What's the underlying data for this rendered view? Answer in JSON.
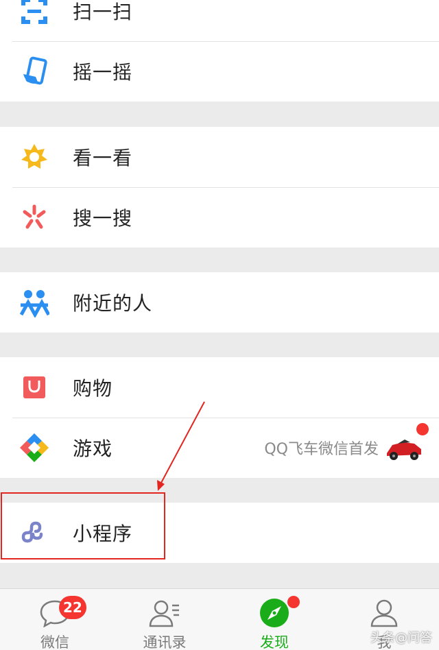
{
  "menu": {
    "scan": "扫一扫",
    "shake": "摇一摇",
    "top_stories": "看一看",
    "search": "搜一搜",
    "people_nearby": "附近的人",
    "shopping": "购物",
    "games": "游戏",
    "games_promo": "QQ飞车微信首发",
    "mini_programs": "小程序"
  },
  "tabbar": {
    "chats": "微信",
    "chats_badge": "22",
    "contacts": "通讯录",
    "discover": "发现",
    "me": "我"
  },
  "watermark": "头条@问答",
  "colors": {
    "accent_green": "#1aad19",
    "badge_red": "#f43530",
    "annotation_red": "#e3241f"
  }
}
